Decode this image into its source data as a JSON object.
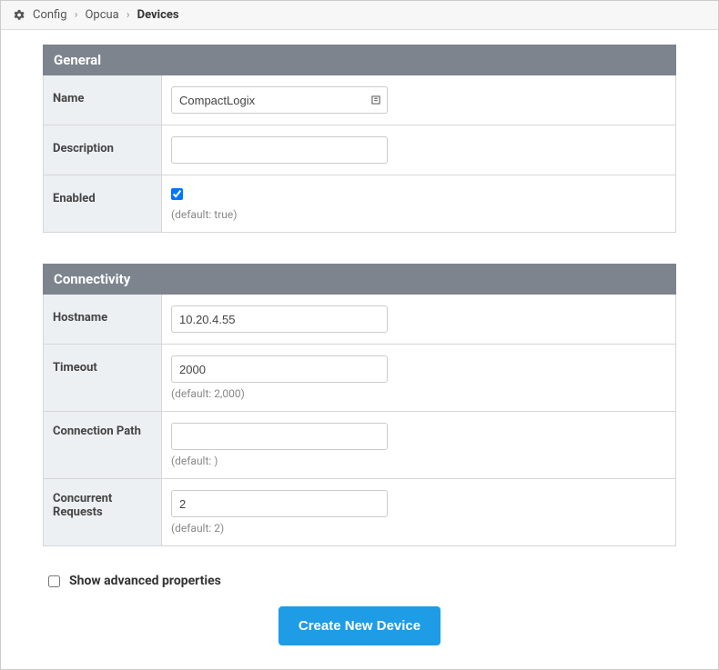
{
  "breadcrumb": {
    "config": "Config",
    "opcua": "Opcua",
    "devices": "Devices"
  },
  "sections": {
    "general": {
      "title": "General",
      "fields": {
        "name": {
          "label": "Name",
          "value": "CompactLogix"
        },
        "description": {
          "label": "Description",
          "value": ""
        },
        "enabled": {
          "label": "Enabled",
          "checked": true,
          "default": "(default: true)"
        }
      }
    },
    "connectivity": {
      "title": "Connectivity",
      "fields": {
        "hostname": {
          "label": "Hostname",
          "value": "10.20.4.55"
        },
        "timeout": {
          "label": "Timeout",
          "value": "2000",
          "default": "(default: 2,000)"
        },
        "connection_path": {
          "label": "Connection Path",
          "value": "",
          "default": "(default: )"
        },
        "concurrent_requests": {
          "label": "Concurrent Requests",
          "value": "2",
          "default": "(default: 2)"
        }
      }
    }
  },
  "advanced": {
    "label": "Show advanced properties",
    "checked": false
  },
  "submit": {
    "label": "Create New Device"
  }
}
